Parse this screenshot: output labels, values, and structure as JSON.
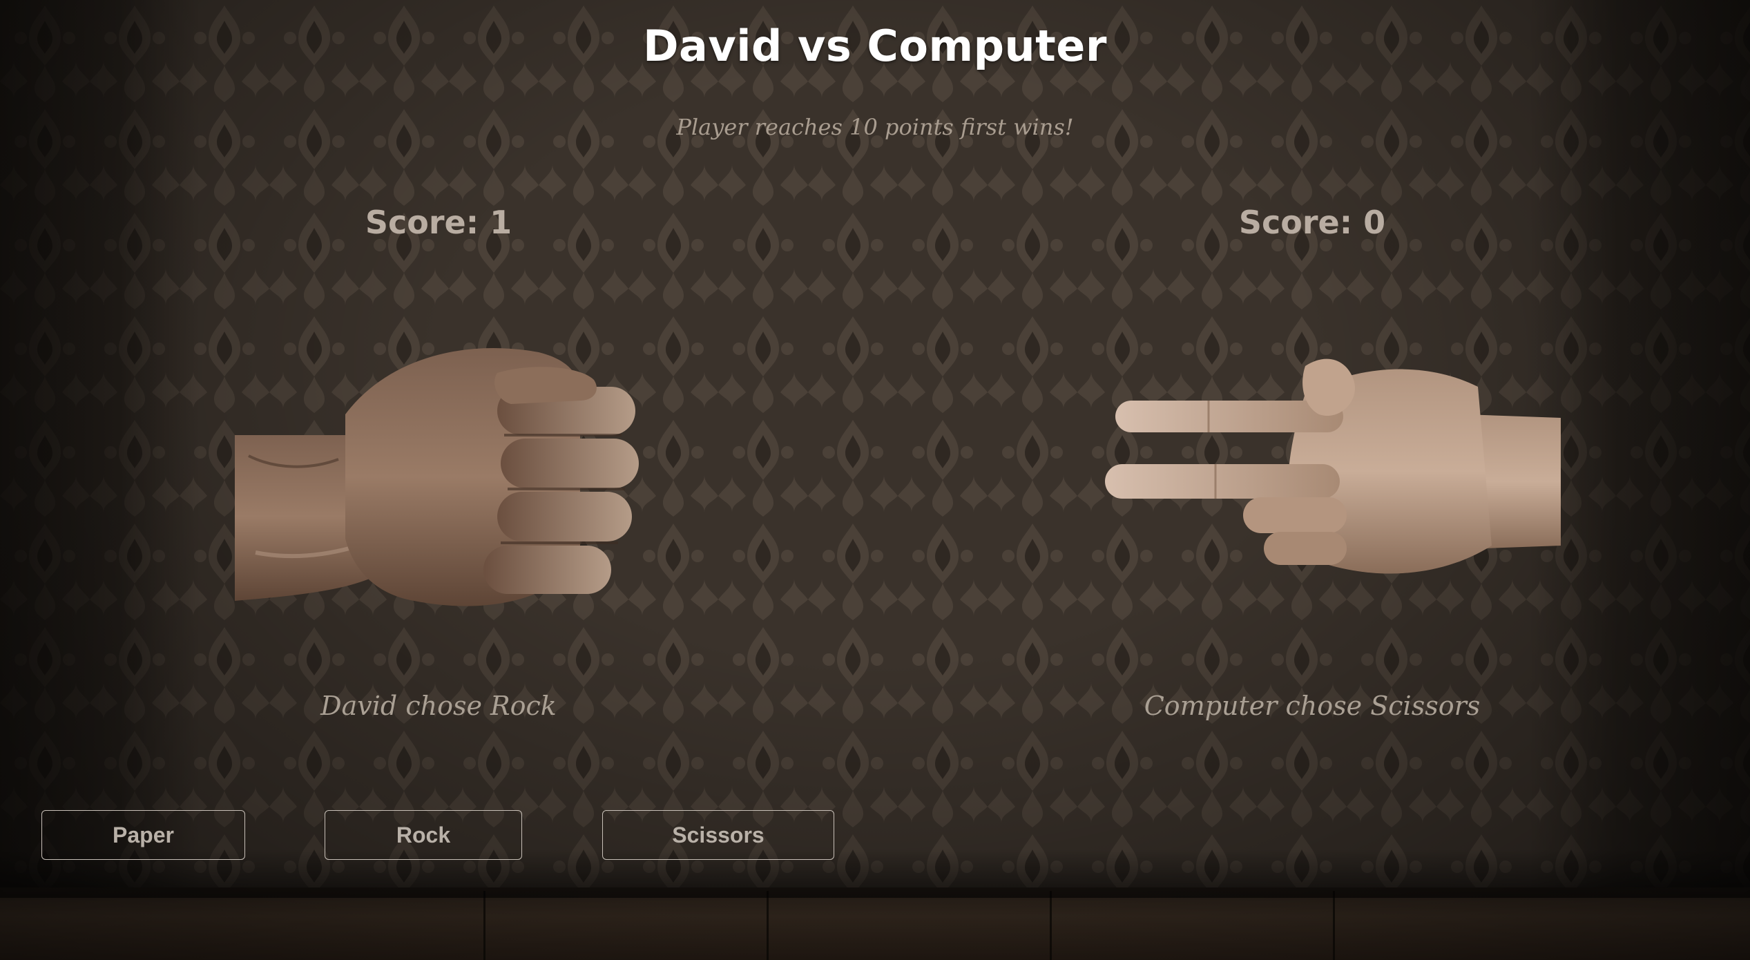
{
  "game": {
    "title": "David vs Computer",
    "subtitle": "Player reaches 10 points first wins!",
    "player": {
      "score_label": "Score: 1",
      "score": 1,
      "choice_text": "David chose Rock",
      "hand": "rock"
    },
    "computer": {
      "score_label": "Score: 0",
      "score": 0,
      "choice_text": "Computer chose Scissors",
      "hand": "scissors"
    },
    "winning_score": 10
  },
  "controls": {
    "paper_label": "Paper",
    "rock_label": "Rock",
    "scissors_label": "Scissors"
  },
  "colors": {
    "wallpaper": "#3a322b",
    "damask": "#4b4138",
    "title": "#ffffff",
    "score": "#b9ada2",
    "button_border": "#c8c0b8",
    "hand_wood": "#8a6a55"
  }
}
